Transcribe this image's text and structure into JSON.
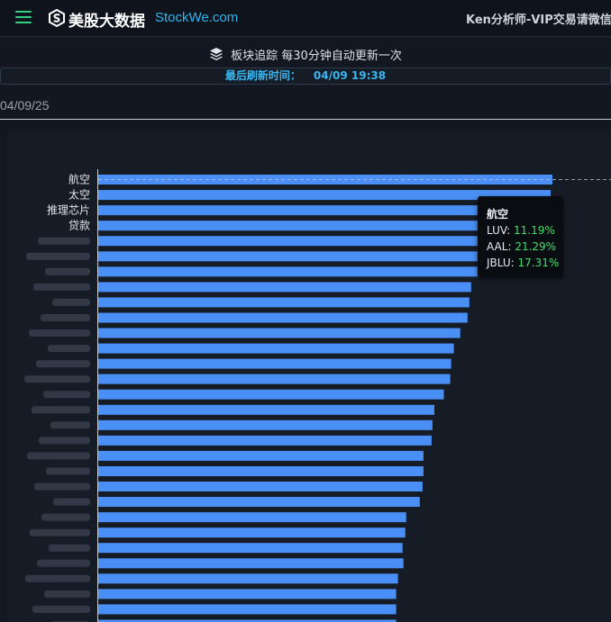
{
  "header": {
    "logo_cn": "美股大数据",
    "logo_en": "StockWe.com",
    "vip_text": "Ken分析师-VIP交易请微信"
  },
  "subtitle": "板块追踪 每30分钟自动更新一次",
  "refresh": {
    "label": "最后刷新时间：",
    "time": "04/09 19:38"
  },
  "date": "04/09/25",
  "tooltip": {
    "title": "航空",
    "rows": [
      {
        "ticker": "LUV:",
        "value": "11.19%"
      },
      {
        "ticker": "AAL:",
        "value": "21.29%"
      },
      {
        "ticker": "JBLU:",
        "value": "17.31%"
      }
    ]
  },
  "colors": {
    "bar": "#4a8ff5",
    "accent": "#2eb6f0",
    "positive": "#3fe06a",
    "menu": "#35d07f"
  },
  "chart_data": {
    "type": "bar",
    "orientation": "horizontal",
    "categories": [
      "航空",
      "太空",
      "推理芯片",
      "贷款",
      "",
      "",
      "",
      "",
      "",
      "",
      "",
      "",
      "",
      "",
      "",
      "",
      "",
      "",
      "",
      "",
      "",
      "",
      "",
      "",
      "",
      "",
      "",
      "",
      "",
      ""
    ],
    "values": [
      100,
      99.6,
      98.6,
      97.2,
      96.1,
      94.1,
      93.1,
      82.1,
      81.7,
      81.3,
      79.7,
      78.3,
      77.7,
      77.5,
      76.1,
      74.0,
      73.6,
      73.4,
      71.6,
      71.6,
      71.4,
      70.8,
      67.8,
      67.6,
      67.0,
      67.2,
      66.0,
      65.6,
      65.6,
      65.6
    ],
    "xlim": [
      0,
      100
    ],
    "grid": false
  }
}
